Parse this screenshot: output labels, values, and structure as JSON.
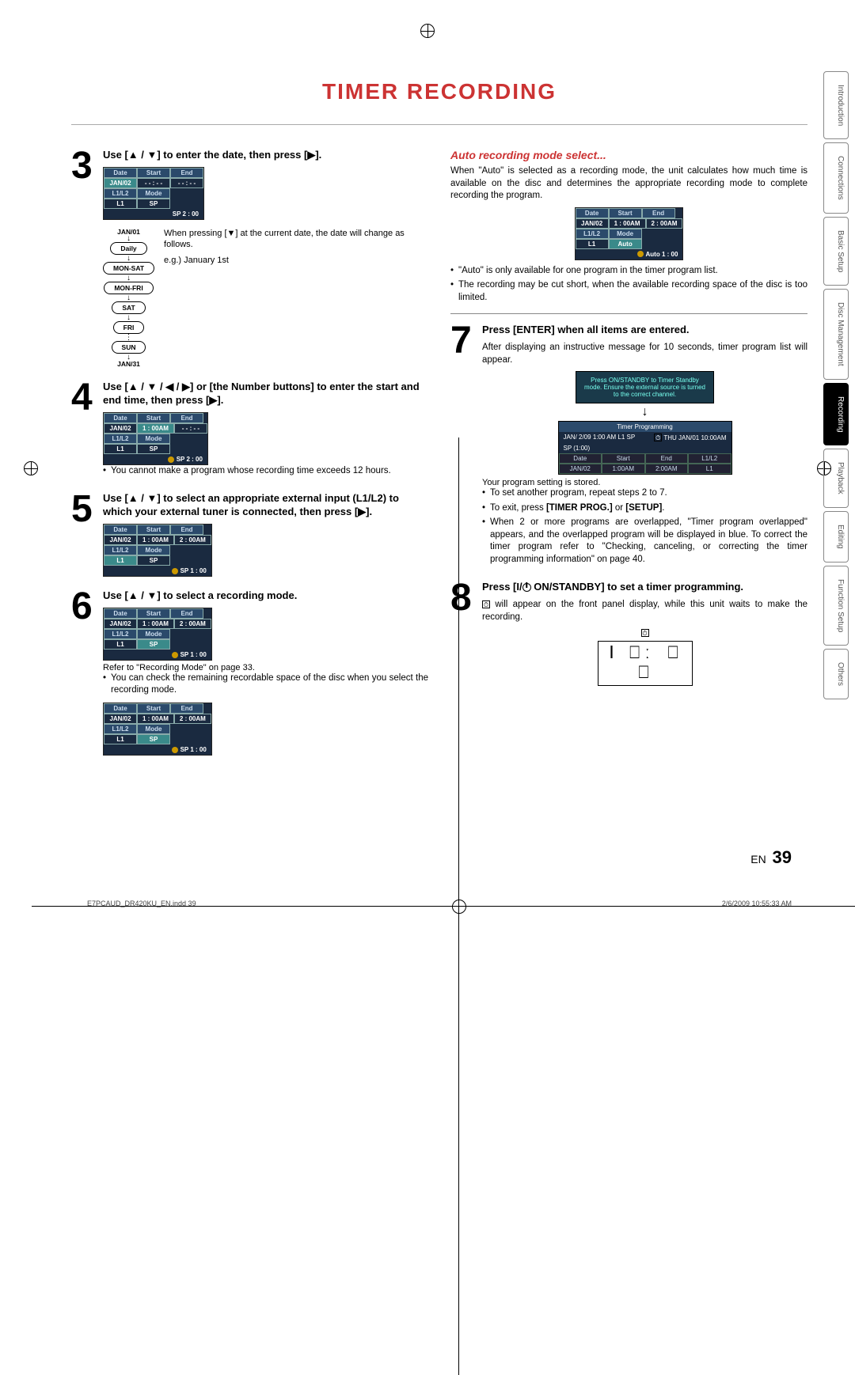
{
  "page_title": "TIMER RECORDING",
  "step3": {
    "title": "Use [▲ / ▼] to enter the date, then press [▶].",
    "table": {
      "date": "JAN/02",
      "start": "- - : - -",
      "end": "- - : - -",
      "mode": "SP",
      "l1": "L1",
      "foot": "SP   2 : 00"
    },
    "cycle": [
      "JAN/01",
      "Daily",
      "MON-SAT",
      "MON-FRI",
      "SAT",
      "FRI",
      "SUN",
      "JAN/31"
    ],
    "cycle_text": "When pressing [▼] at the current date, the date will change as follows.",
    "cycle_eg": "e.g.) January 1st"
  },
  "step4": {
    "title": "Use [▲ / ▼ / ◀ / ▶] or [the Number buttons] to enter the start and end time, then press [▶].",
    "table": {
      "date": "JAN/02",
      "start": "1 : 00AM",
      "end": "- - : - -",
      "mode": "SP",
      "l1": "L1",
      "foot": "SP   2 : 00"
    },
    "note": "You cannot make a program whose recording time exceeds 12 hours."
  },
  "step5": {
    "title": "Use [▲ / ▼] to select an appropriate external input (L1/L2) to which your external tuner is connected, then press [▶].",
    "table": {
      "date": "JAN/02",
      "start": "1 : 00AM",
      "end": "2 : 00AM",
      "mode": "SP",
      "l1": "L1",
      "foot": "SP   1 : 00"
    }
  },
  "step6": {
    "title": "Use [▲ / ▼] to select a recording mode.",
    "table": {
      "date": "JAN/02",
      "start": "1 : 00AM",
      "end": "2 : 00AM",
      "mode": "SP",
      "l1": "L1",
      "foot": "SP   1 : 00"
    },
    "caption": "Refer to \"Recording Mode\" on page 33.",
    "note": "You can check the remaining recordable space of the disc when you select the recording mode.",
    "table2": {
      "date": "JAN/02",
      "start": "1 : 00AM",
      "end": "2 : 00AM",
      "mode": "SP",
      "l1": "L1",
      "foot": "SP   1 : 00"
    }
  },
  "auto": {
    "heading": "Auto recording mode select...",
    "para": "When \"Auto\" is selected as a recording mode, the unit calculates how much time is available on the disc and determines the appropriate recording mode to complete recording the program.",
    "table": {
      "date": "JAN/02",
      "start": "1 : 00AM",
      "end": "2 : 00AM",
      "mode": "Auto",
      "l1": "L1",
      "foot": "Auto   1 : 00"
    },
    "b1": "\"Auto\" is only available for one program in the timer program list.",
    "b2": "The recording may be cut short, when the available recording space of the disc is too limited."
  },
  "step7": {
    "title": "Press [ENTER] when all items are entered.",
    "para": "After displaying an instructive message for 10 seconds, timer program list will appear.",
    "msg": "Press ON/STANDBY to Timer Standby mode. Ensure the external source is turned to the correct channel.",
    "list_title": "Timer Programming",
    "list_line": "JAN/ 2/09 1:00 AM L1 SP",
    "list_line_r": "THU JAN/01 10:00AM",
    "list_sp": "SP (1:00)",
    "row": {
      "date": "JAN/02",
      "start": "1:00AM",
      "end": "2:00AM",
      "l1": "L1"
    },
    "caption": "Your program setting is stored.",
    "b1": "To set another program, repeat steps 2 to 7.",
    "b2": "To exit, press [TIMER PROG.] or [SETUP].",
    "b3": "When 2 or more programs are overlapped, \"Timer program overlapped\" appears, and the overlapped program will be displayed in blue. To correct the timer program refer to \"Checking, canceling, or correcting the timer programming information\" on page 40."
  },
  "step8": {
    "title_a": "Press [I/",
    "title_b": " ON/STANDBY] to set a timer programming.",
    "para": " will appear on the front panel display, while this unit waits to make the recording.",
    "seg": "Ⅰ ⎕ː ⎕ ⎕"
  },
  "tabs": [
    "Introduction",
    "Connections",
    "Basic Setup",
    "Disc Management",
    "Recording",
    "Playback",
    "Editing",
    "Function Setup",
    "Others"
  ],
  "active_tab": 4,
  "footer_left": "E7PCAUD_DR420KU_EN.indd   39",
  "footer_right": "2/6/2009   10:55:33 AM",
  "page_lang": "EN",
  "page_num": "39"
}
